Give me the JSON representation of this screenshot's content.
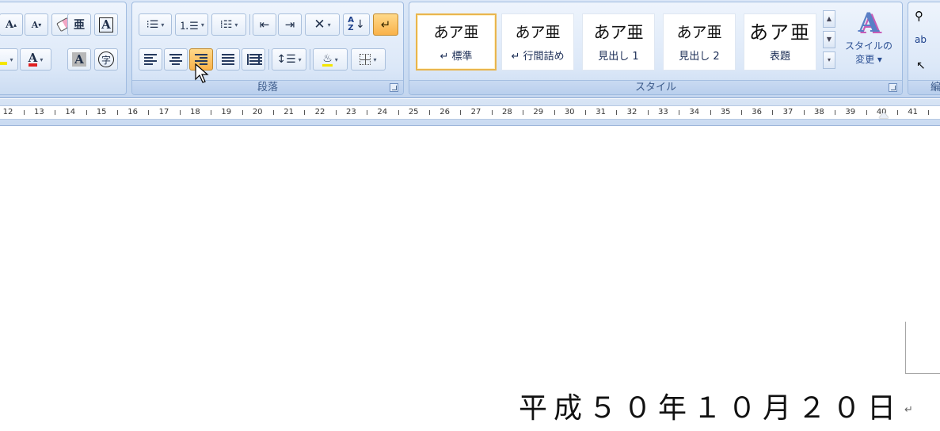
{
  "ribbon": {
    "font_group": {
      "buttons": {
        "grow_font": "A",
        "shrink_font": "A",
        "phonetic_guide": "亜",
        "char_border": "A",
        "font_color": "A",
        "char_shading": "A",
        "enclose_char": "字"
      },
      "font_color_hex": "#e02020",
      "highlight_color_hex": "#f4e600"
    },
    "paragraph_group": {
      "label": "段落",
      "sort_label": "AZ",
      "active_button": "align-right"
    },
    "styles_group": {
      "label": "スタイル",
      "tiles": [
        {
          "sample": "あア亜",
          "name": "↵ 標準",
          "selected": true
        },
        {
          "sample": "あア亜",
          "name": "↵ 行間詰め",
          "selected": false
        },
        {
          "sample": "あア亜",
          "name": "見出し 1",
          "selected": false
        },
        {
          "sample": "あア亜",
          "name": "見出し 2",
          "selected": false
        },
        {
          "sample": "あア亜",
          "name": "表題",
          "selected": false
        }
      ],
      "change_styles_label_1": "スタイルの",
      "change_styles_label_2": "変更 ▾"
    },
    "editing_group": {
      "label_partial": "編"
    }
  },
  "ruler": {
    "labels": [
      "12",
      "13",
      "14",
      "15",
      "16",
      "17",
      "18",
      "19",
      "20",
      "21",
      "22",
      "23",
      "24",
      "25",
      "26",
      "27",
      "28",
      "29",
      "30",
      "31",
      "32",
      "33",
      "34",
      "35",
      "36",
      "37",
      "38",
      "39",
      "40",
      "41"
    ]
  },
  "document": {
    "date_text": "平成５０年１０月２０日",
    "paragraph_mark": "↵"
  }
}
